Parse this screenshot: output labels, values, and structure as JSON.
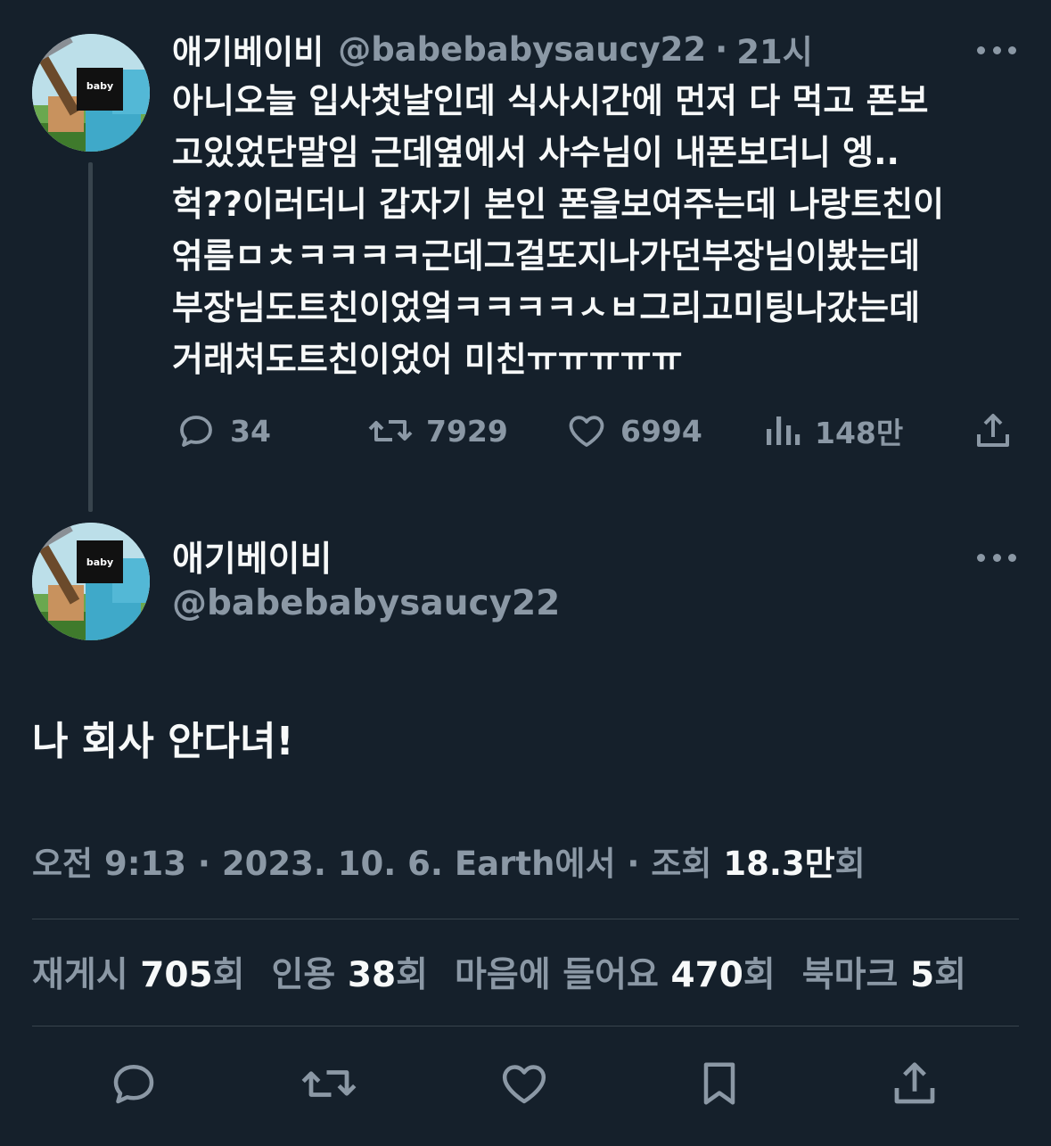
{
  "tweet": {
    "author_name": "애기베이비",
    "author_handle": "@babebabysaucy22",
    "time_sep": "·",
    "time": "21시",
    "avatar_badge": "baby",
    "text": "아니오늘 입사첫날인데 식사시간에 먼저 다 먹고 폰보\n고있었단말임 근데옆에서 사수님이 내폰보더니 엥..\n헉??이러더니 갑자기 본인 폰을보여주는데 나랑트친이\n얶름ㅁㅊㅋㅋㅋㅋ근데그걸또지나가던부장님이봤는데\n부장님도트친이었엌ㅋㅋㅋㅋㅅㅂ그리고미팅나갔는데\n거래처도트친이었어 미친ㅠㅠㅠㅠㅠ",
    "actions": {
      "reply": {
        "icon": "reply-icon",
        "count": "34"
      },
      "retweet": {
        "icon": "retweet-icon",
        "count": "7929"
      },
      "like": {
        "icon": "heart-icon",
        "count": "6994"
      },
      "views": {
        "icon": "views-icon",
        "count": "148만"
      },
      "share": {
        "icon": "share-icon"
      }
    }
  },
  "reply": {
    "author_name": "애기베이비",
    "author_handle": "@babebabysaucy22",
    "avatar_badge": "baby",
    "text": "나 회사 안다녀!",
    "meta": {
      "time": "오전 9:13",
      "sep1": "·",
      "date": "2023. 10. 6.",
      "source": "Earth에서",
      "sep2": "·",
      "views_label": "조회",
      "views_value": "18.3만",
      "views_suffix": "회"
    },
    "stats": [
      {
        "label": "재게시",
        "value": "705",
        "suffix": "회"
      },
      {
        "label": "인용",
        "value": "38",
        "suffix": "회"
      },
      {
        "label": "마음에 들어요",
        "value": "470",
        "suffix": "회"
      },
      {
        "label": "북마크",
        "value": "5",
        "suffix": "회"
      }
    ],
    "bottom_actions": [
      "reply-icon",
      "retweet-icon",
      "heart-icon",
      "bookmark-icon",
      "share-icon"
    ]
  },
  "colors": {
    "background": "#15202b",
    "text_primary": "#f7f9f9",
    "text_secondary": "#8b98a5",
    "divider": "#38444d"
  }
}
